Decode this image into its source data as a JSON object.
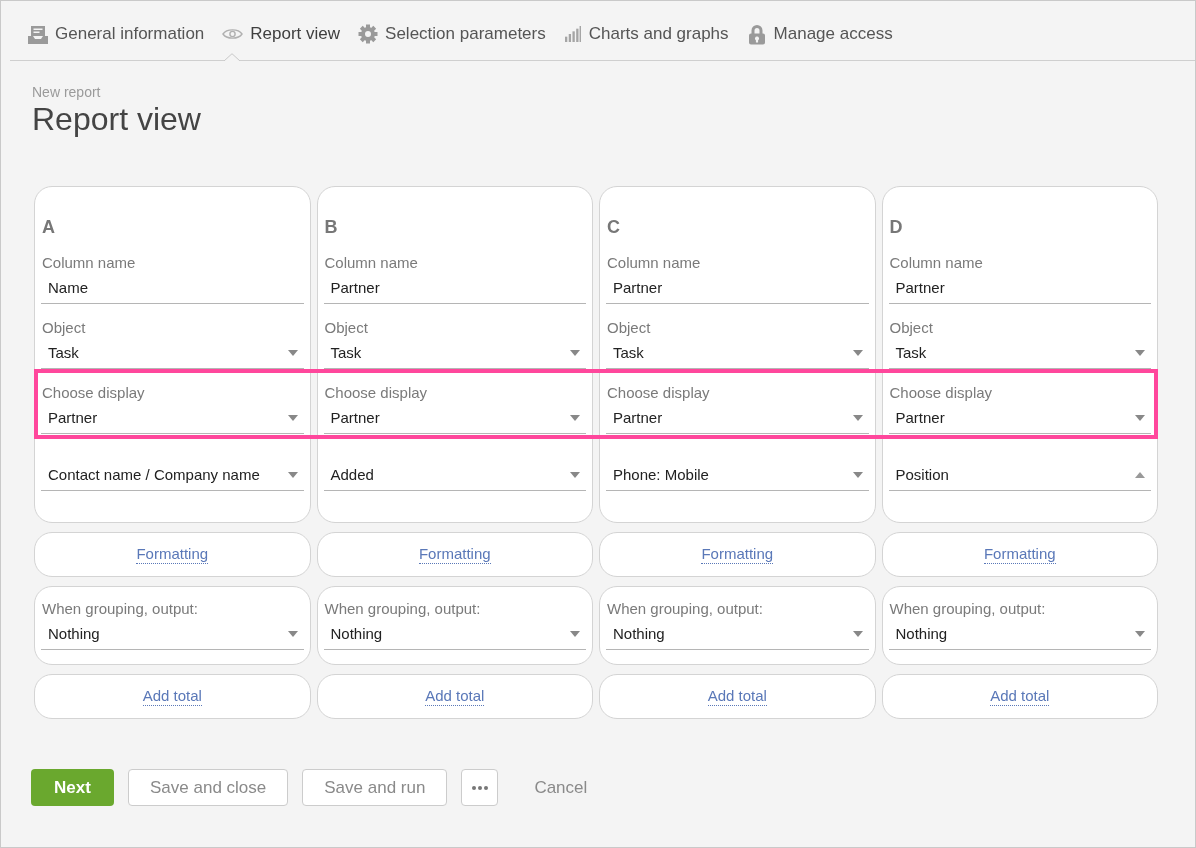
{
  "tabs": [
    {
      "label": "General information",
      "selected": false
    },
    {
      "label": "Report view",
      "selected": true
    },
    {
      "label": "Selection parameters",
      "selected": false
    },
    {
      "label": "Charts and graphs",
      "selected": false
    },
    {
      "label": "Manage access",
      "selected": false
    }
  ],
  "header": {
    "breadcrumb": "New report",
    "title": "Report view"
  },
  "columns": [
    {
      "letter": "A",
      "fields": [
        {
          "kind": "text",
          "label": "Column name",
          "value": "Name",
          "highlighted": false
        },
        {
          "kind": "select",
          "label": "Object",
          "value": "Task",
          "expanded": false,
          "highlighted": false
        },
        {
          "kind": "select",
          "label": "Choose display",
          "value": "Partner",
          "expanded": false,
          "highlighted": true
        },
        {
          "kind": "select",
          "value": "Contact name / Company name",
          "expanded": false,
          "highlighted": false
        }
      ],
      "formatting_link": "Formatting",
      "grouping": {
        "label": "When grouping, output:",
        "value": "Nothing",
        "expanded": false
      },
      "total_link": "Add total"
    },
    {
      "letter": "B",
      "fields": [
        {
          "kind": "text",
          "label": "Column name",
          "value": "Partner",
          "highlighted": false
        },
        {
          "kind": "select",
          "label": "Object",
          "value": "Task",
          "expanded": false,
          "highlighted": false
        },
        {
          "kind": "select",
          "label": "Choose display",
          "value": "Partner",
          "expanded": false,
          "highlighted": true
        },
        {
          "kind": "select",
          "value": "Added",
          "expanded": false,
          "highlighted": false
        }
      ],
      "formatting_link": "Formatting",
      "grouping": {
        "label": "When grouping, output:",
        "value": "Nothing",
        "expanded": false
      },
      "total_link": "Add total"
    },
    {
      "letter": "C",
      "fields": [
        {
          "kind": "text",
          "label": "Column name",
          "value": "Partner",
          "highlighted": false
        },
        {
          "kind": "select",
          "label": "Object",
          "value": "Task",
          "expanded": false,
          "highlighted": false
        },
        {
          "kind": "select",
          "label": "Choose display",
          "value": "Partner",
          "expanded": false,
          "highlighted": true
        },
        {
          "kind": "select",
          "value": "Phone: Mobile",
          "expanded": false,
          "highlighted": false
        }
      ],
      "formatting_link": "Formatting",
      "grouping": {
        "label": "When grouping, output:",
        "value": "Nothing",
        "expanded": false
      },
      "total_link": "Add total"
    },
    {
      "letter": "D",
      "fields": [
        {
          "kind": "text",
          "label": "Column name",
          "value": "Partner",
          "highlighted": false
        },
        {
          "kind": "select",
          "label": "Object",
          "value": "Task",
          "expanded": false,
          "highlighted": false
        },
        {
          "kind": "select",
          "label": "Choose display",
          "value": "Partner",
          "expanded": false,
          "highlighted": true
        },
        {
          "kind": "select",
          "value": "Position",
          "expanded": true,
          "highlighted": false
        }
      ],
      "formatting_link": "Formatting",
      "grouping": {
        "label": "When grouping, output:",
        "value": "Nothing",
        "expanded": false
      },
      "total_link": "Add total"
    }
  ],
  "actions": [
    {
      "kind": "primary",
      "label": "Next"
    },
    {
      "kind": "secondary",
      "label": "Save and close"
    },
    {
      "kind": "secondary",
      "label": "Save and run"
    },
    {
      "kind": "more"
    },
    {
      "kind": "link",
      "label": "Cancel"
    }
  ]
}
